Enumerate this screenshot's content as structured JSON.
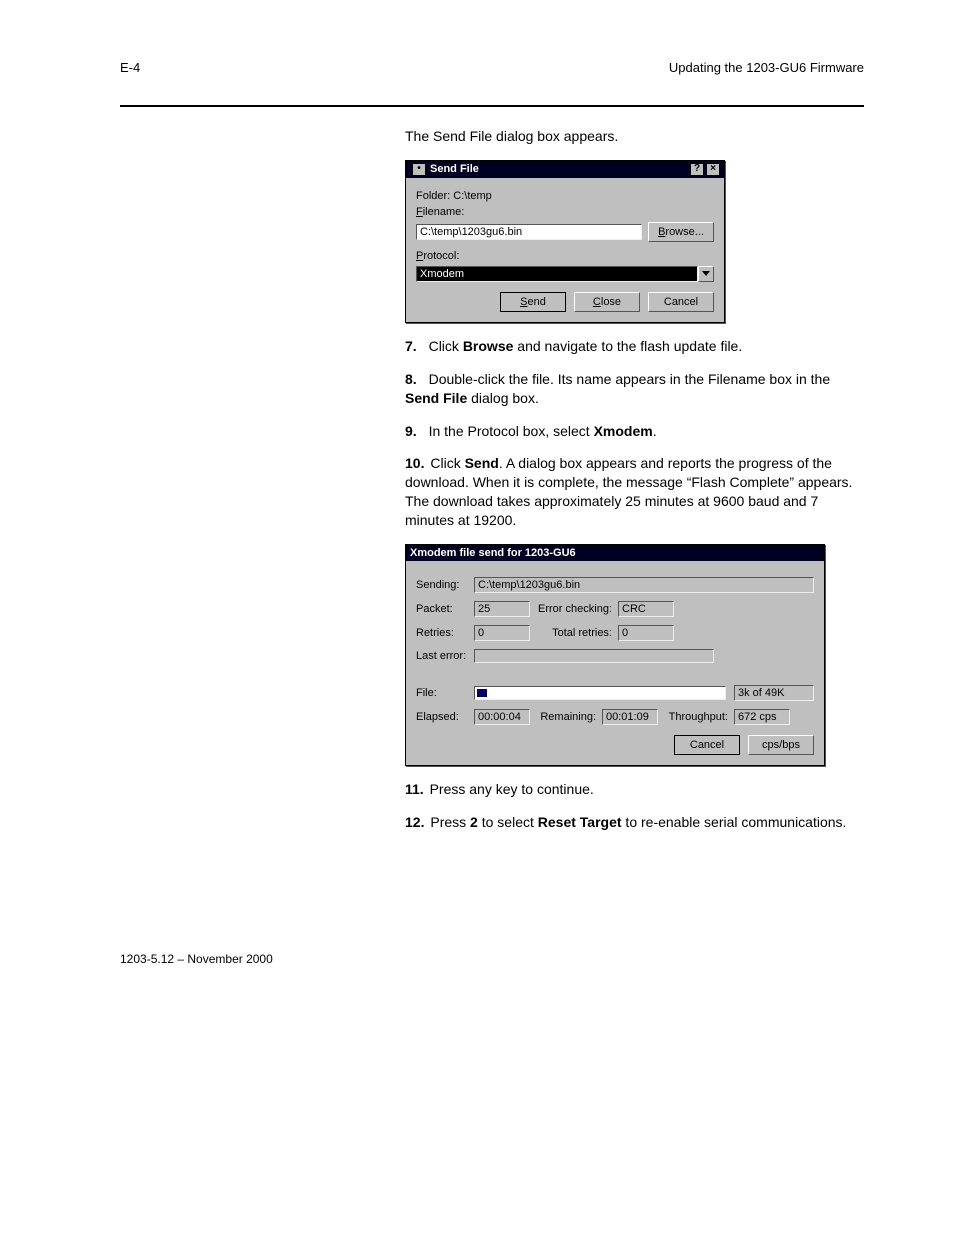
{
  "header": {
    "page": "E-4",
    "title": "Updating the 1203-GU6 Firmware"
  },
  "intro": "The Send File dialog box appears.",
  "sendfile": {
    "title": "Send File",
    "help_glyph": "?",
    "close_glyph": "×",
    "folder_label": "Folder:  C:\\temp",
    "filename_label": "Filename:",
    "filename_value": "C:\\temp\\1203gu6.bin",
    "browse_label": "Browse...",
    "protocol_label": "Protocol:",
    "protocol_value": "Xmodem",
    "send_label": "Send",
    "close_label": "Close",
    "cancel_label": "Cancel"
  },
  "steps": {
    "s7": {
      "num": "7.",
      "text": "Click Browse and navigate to the flash update file."
    },
    "s8": {
      "num": "8.",
      "text": "Double-click the file. Its name appears in the Filename box in the Send File dialog box."
    },
    "s9": {
      "num": "9.",
      "text": "In the Protocol box, select Xmodem."
    },
    "s10": {
      "num": "10.",
      "text": "Click Send. A dialog box appears and reports the progress of the download. When it is complete, the message “Flash Complete” appears. The download takes approximately 25 minutes at 9600 baud and 7 minutes at 19200."
    },
    "s11": {
      "num": "11.",
      "text": "Press any key to continue."
    },
    "s12": {
      "num": "12.",
      "text": "Press 2 to select Reset Target to re-enable serial communications."
    }
  },
  "progress": {
    "title": "Xmodem file send for 1203-GU6",
    "sending_label": "Sending:",
    "sending_value": "C:\\temp\\1203gu6.bin",
    "packet_label": "Packet:",
    "packet_value": "25",
    "errchk_label": "Error checking:",
    "errchk_value": "CRC",
    "retries_label": "Retries:",
    "retries_value": "0",
    "totret_label": "Total retries:",
    "totret_value": "0",
    "lasterr_label": "Last error:",
    "lasterr_value": "",
    "file_label": "File:",
    "file_progress_text": "3k of 49K",
    "elapsed_label": "Elapsed:",
    "elapsed_value": "00:00:04",
    "remaining_label": "Remaining:",
    "remaining_value": "00:01:09",
    "throughput_label": "Throughput:",
    "throughput_value": "672 cps",
    "cancel_label": "Cancel",
    "cpsbps_label": "cps/bps"
  },
  "footer": "1203-5.12 – November 2000"
}
